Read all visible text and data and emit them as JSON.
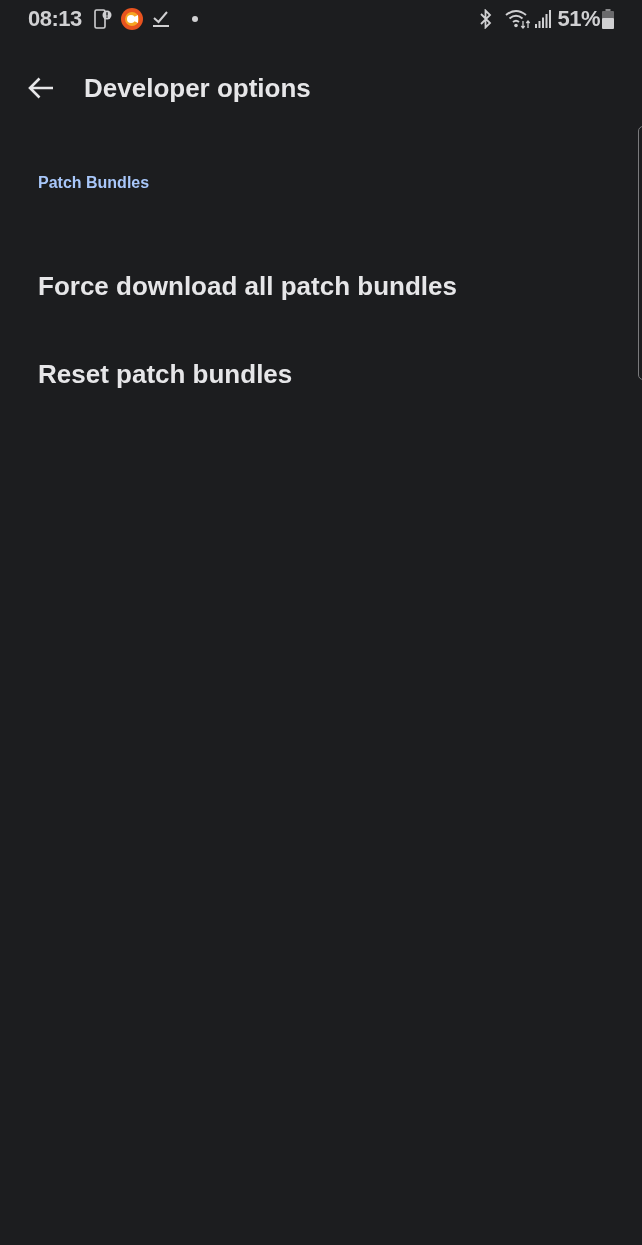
{
  "status_bar": {
    "time": "08:13",
    "battery_percent": "51%"
  },
  "top_bar": {
    "title": "Developer options"
  },
  "sections": [
    {
      "header": "Patch Bundles",
      "items": [
        {
          "title": "Force download all patch bundles"
        },
        {
          "title": "Reset patch bundles"
        }
      ]
    }
  ]
}
